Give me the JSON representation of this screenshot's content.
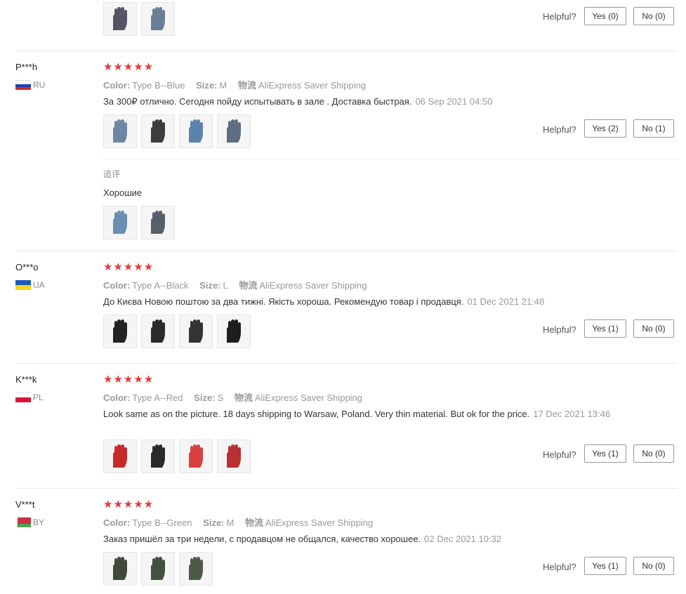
{
  "labels": {
    "color": "Color:",
    "size": "Size:",
    "shipping": "物流",
    "helpful": "Helpful?"
  },
  "top": {
    "yes": "Yes (0)",
    "no": "No (0)"
  },
  "reviews": [
    {
      "user": "P***h",
      "country": "RU",
      "stars": "★★★★★",
      "color": "Type B--Blue",
      "size": "M",
      "shipping": "AliExpress Saver Shipping",
      "text": "За 300₽ отлично. Сегодня пойду испытывать в зале . Доставка быстрая.",
      "date": "06 Sep 2021 04:50",
      "yes": "Yes (2)",
      "no": "No (1)",
      "followup_label": "追评",
      "followup_text": "Хорошие"
    },
    {
      "user": "O***o",
      "country": "UA",
      "stars": "★★★★★",
      "color": "Type A--Black",
      "size": "L",
      "shipping": "AliExpress Saver Shipping",
      "text": "До Києва Новою поштою за два тижні. Якість хороша. Рекомендую товар і продавця.",
      "date": "01 Dec 2021 21:48",
      "yes": "Yes (1)",
      "no": "No (0)"
    },
    {
      "user": "K***k",
      "country": "PL",
      "stars": "★★★★★",
      "color": "Type A--Red",
      "size": "S",
      "shipping": "AliExpress Saver Shipping",
      "text": "Look same as on the picture. 18 days shipping to Warsaw, Poland. Very thin material. But ok for the price.",
      "date": "17 Dec 2021 13:46",
      "yes": "Yes (1)",
      "no": "No (0)"
    },
    {
      "user": "V***t",
      "country": "BY",
      "stars": "★★★★★",
      "color": "Type B--Green",
      "size": "M",
      "shipping": "AliExpress Saver Shipping",
      "text": "Заказ пришёл за три недели, с продавцом не общался, качество хорошее.",
      "date": "02 Dec 2021 10:32",
      "yes": "Yes (1)",
      "no": "No (0)"
    }
  ],
  "colors": {
    "star": "#e23a3a",
    "muted": "#999999",
    "border": "#e8e8e8"
  }
}
